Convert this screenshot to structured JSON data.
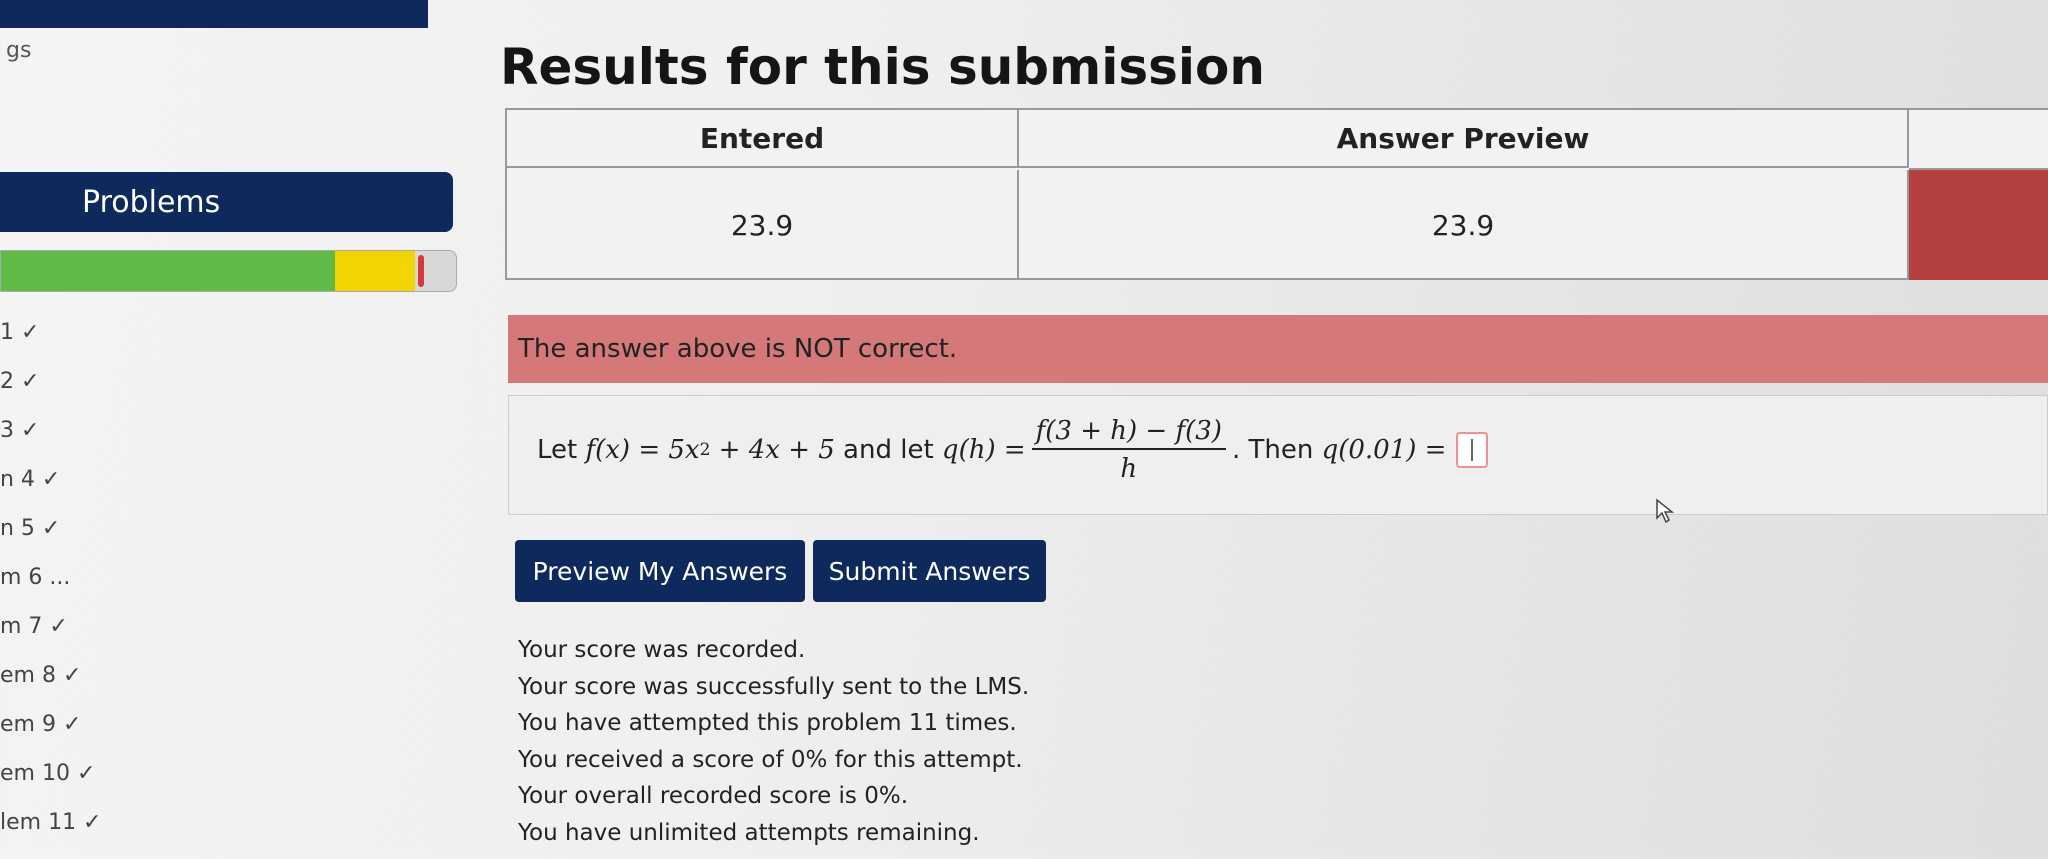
{
  "sidebar": {
    "header_fragment": "gs",
    "problems_label": "Problems",
    "progress": {
      "correct_fraction": 0.73,
      "partial_fraction": 0.18,
      "colors": {
        "correct": "#5dbb46",
        "partial": "#f2d500",
        "incorrect": "#d23a3a"
      }
    },
    "items": [
      {
        "label": "1 ✓"
      },
      {
        "label": "2 ✓"
      },
      {
        "label": "3 ✓"
      },
      {
        "label": "n 4 ✓"
      },
      {
        "label": "n 5 ✓"
      },
      {
        "label": "m 6 ..."
      },
      {
        "label": "m 7 ✓"
      },
      {
        "label": "em 8 ✓"
      },
      {
        "label": "em 9 ✓"
      },
      {
        "label": "em 10 ✓"
      },
      {
        "label": "lem 11 ✓"
      }
    ]
  },
  "main": {
    "title": "Results for this submission",
    "table": {
      "headers": {
        "entered": "Entered",
        "preview": "Answer Preview"
      },
      "row": {
        "entered": "23.9",
        "preview": "23.9"
      }
    },
    "alert": "The answer above is NOT correct.",
    "problem": {
      "let": "Let",
      "fx": "f(x) = 5x",
      "exp": "2",
      "fx_rest": " + 4x + 5",
      "and_let": " and let ",
      "qh": "q(h) =",
      "numerator": "f(3 + h) − f(3)",
      "denominator": "h",
      "then": ". Then ",
      "q_eval": "q(0.01) ="
    },
    "buttons": {
      "preview": "Preview My Answers",
      "submit": "Submit Answers"
    },
    "score_lines": [
      "Your score was recorded.",
      "Your score was successfully sent to the LMS.",
      "You have attempted this problem 11 times.",
      "You received a score of 0% for this attempt.",
      "Your overall recorded score is 0%.",
      "You have unlimited attempts remaining."
    ]
  },
  "colors": {
    "nav": "#0e2a5c",
    "alert": "#d5787a",
    "incorrect_cell": "#b4413f"
  }
}
